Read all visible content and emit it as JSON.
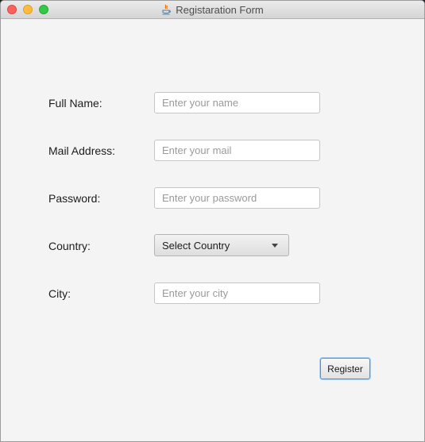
{
  "window": {
    "title": "Registaration Form"
  },
  "form": {
    "full_name": {
      "label": "Full Name:",
      "placeholder": "Enter your name"
    },
    "mail": {
      "label": "Mail Address:",
      "placeholder": "Enter your mail"
    },
    "password": {
      "label": "Password:",
      "placeholder": "Enter your password"
    },
    "country": {
      "label": "Country:",
      "selected": "Select Country"
    },
    "city": {
      "label": "City:",
      "placeholder": "Enter your city"
    },
    "register_label": "Register"
  },
  "icons": {
    "title_icon": "java-icon",
    "country_dropdown": "chevron-down-icon"
  },
  "colors": {
    "close": "#fc605c",
    "minimize": "#fdbc40",
    "zoom": "#34c84a",
    "focus_accent": "#3d9be4"
  }
}
